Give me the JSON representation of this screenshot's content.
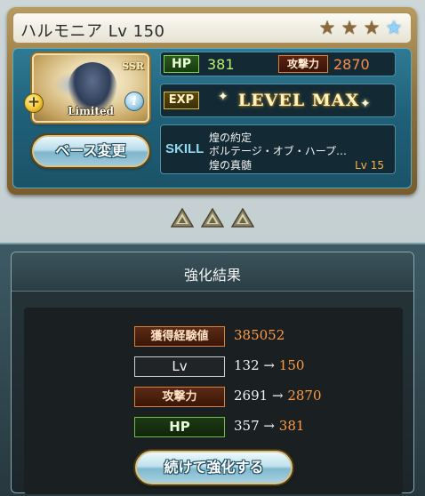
{
  "character": {
    "title": "ハルモニア Lv 150",
    "rarity_badge": "SSR",
    "limited_label": "Limited",
    "plus_icon": "+",
    "info_icon": "i",
    "stars": [
      {
        "icon": "star-bronze-icon",
        "glyph": "★"
      },
      {
        "icon": "star-bronze-icon",
        "glyph": "★"
      },
      {
        "icon": "star-bronze-icon",
        "glyph": "★"
      },
      {
        "icon": "star-blue-icon",
        "glyph": "★"
      }
    ]
  },
  "stats": {
    "hp_label": "HP",
    "hp_value": "381",
    "atk_label": "攻撃力",
    "atk_value": "2870",
    "exp_label": "EXP",
    "exp_status": "LEVEL MAX"
  },
  "skill": {
    "label": "SKILL",
    "lines": [
      "煌の約定",
      "ボルテージ・オブ・ハープ…",
      "煌の真髄"
    ],
    "level": "Lv 15"
  },
  "buttons": {
    "base_change": "ベース変更",
    "continue": "続けて強化する"
  },
  "result": {
    "title": "強化結果",
    "rows": [
      {
        "label": "獲得経験値",
        "value": "385052"
      },
      {
        "label": "Lv",
        "old": "132",
        "arrow": "→",
        "new": "150"
      },
      {
        "label": "攻撃力",
        "old": "2691",
        "arrow": "→",
        "new": "2870"
      },
      {
        "label": "HP",
        "old": "357",
        "arrow": "→",
        "new": "381"
      }
    ]
  },
  "colors": {
    "hp_value": "#b8f06a",
    "atk_value": "#ff8a4a",
    "result_new_value": "#ff9a42",
    "accent_gold": "#d9c48a"
  }
}
